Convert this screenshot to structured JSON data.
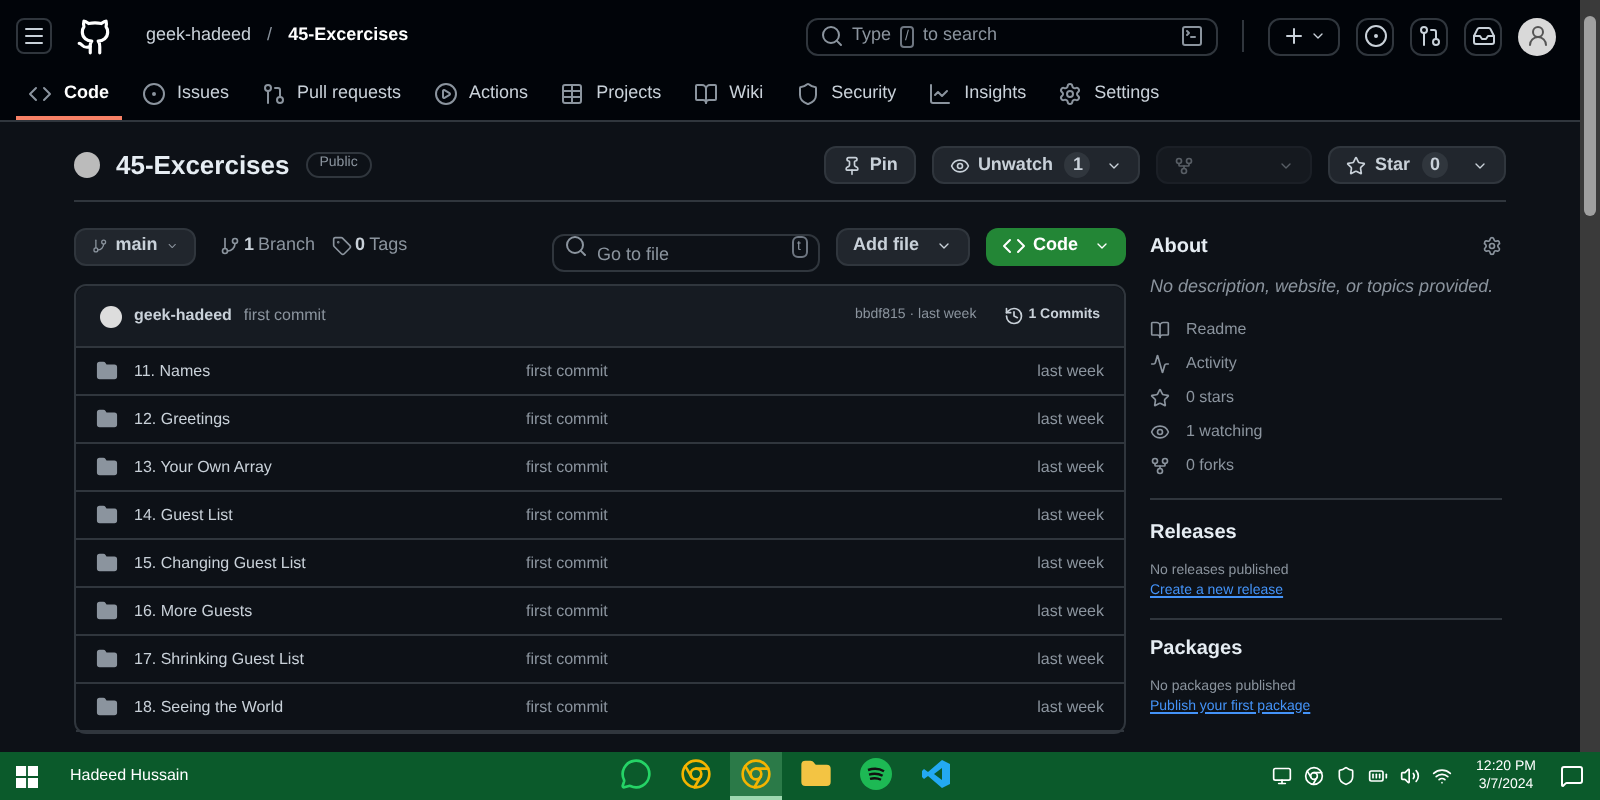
{
  "header": {
    "owner": "geek-hadeed",
    "separator": "/",
    "repo": "45-Excercises",
    "search": {
      "before": "Type",
      "key": "/",
      "after": "to search"
    }
  },
  "nav_tabs": [
    {
      "label": "Code",
      "kind": "code",
      "selected": true
    },
    {
      "label": "Issues",
      "kind": "issues",
      "selected": false
    },
    {
      "label": "Pull requests",
      "kind": "pulls",
      "selected": false
    },
    {
      "label": "Actions",
      "kind": "actions",
      "selected": false
    },
    {
      "label": "Projects",
      "kind": "projects",
      "selected": false
    },
    {
      "label": "Wiki",
      "kind": "wiki",
      "selected": false
    },
    {
      "label": "Security",
      "kind": "security",
      "selected": false
    },
    {
      "label": "Insights",
      "kind": "insights",
      "selected": false
    },
    {
      "label": "Settings",
      "kind": "settings",
      "selected": false
    }
  ],
  "repo": {
    "name": "45-Excercises",
    "visibility": "Public",
    "pin": "Pin",
    "watch": {
      "label": "Unwatch",
      "count": "1"
    },
    "fork": {
      "disabled": true
    },
    "star": {
      "label": "Star",
      "count": "0"
    }
  },
  "toolbar": {
    "branch": "main",
    "branch_count": "1",
    "branch_label": "Branch",
    "tag_count": "0",
    "tag_label": "Tags",
    "file_search": {
      "placeholder": "Go to file",
      "key": "t"
    },
    "add_file": "Add file",
    "code": "Code"
  },
  "commit": {
    "author": "geek-hadeed",
    "message": "first commit",
    "hash": "bbdf815 · last week",
    "commits": "1 Commits"
  },
  "files": [
    {
      "name": "11. Names",
      "message": "first commit",
      "time": "last week"
    },
    {
      "name": "12. Greetings",
      "message": "first commit",
      "time": "last week"
    },
    {
      "name": "13. Your Own Array",
      "message": "first commit",
      "time": "last week"
    },
    {
      "name": "14. Guest List",
      "message": "first commit",
      "time": "last week"
    },
    {
      "name": "15. Changing Guest List",
      "message": "first commit",
      "time": "last week"
    },
    {
      "name": "16. More Guests",
      "message": "first commit",
      "time": "last week"
    },
    {
      "name": "17. Shrinking Guest List",
      "message": "first commit",
      "time": "last week"
    },
    {
      "name": "18. Seeing the World",
      "message": "first commit",
      "time": "last week"
    }
  ],
  "about": {
    "title": "About",
    "description": "No description, website, or topics provided.",
    "items": [
      {
        "kind": "readme",
        "text": "Readme"
      },
      {
        "kind": "activity",
        "text": "Activity"
      },
      {
        "kind": "stars",
        "text": "0 stars"
      },
      {
        "kind": "watching",
        "text": "1 watching"
      },
      {
        "kind": "forks",
        "text": "0 forks"
      }
    ]
  },
  "releases": {
    "title": "Releases",
    "text": "No releases published",
    "link": "Create a new release"
  },
  "packages": {
    "title": "Packages",
    "text": "No packages published",
    "link": "Publish your first package"
  },
  "taskbar": {
    "user": "Hadeed Hussain",
    "apps": [
      {
        "kind": "whatsapp",
        "selected": false
      },
      {
        "kind": "chrome",
        "selected": false
      },
      {
        "kind": "chrome",
        "selected": true
      },
      {
        "kind": "files",
        "selected": false
      },
      {
        "kind": "spotify",
        "selected": false
      },
      {
        "kind": "vscode",
        "selected": false
      }
    ],
    "time": "12:20 PM",
    "date": "3/7/2024"
  }
}
